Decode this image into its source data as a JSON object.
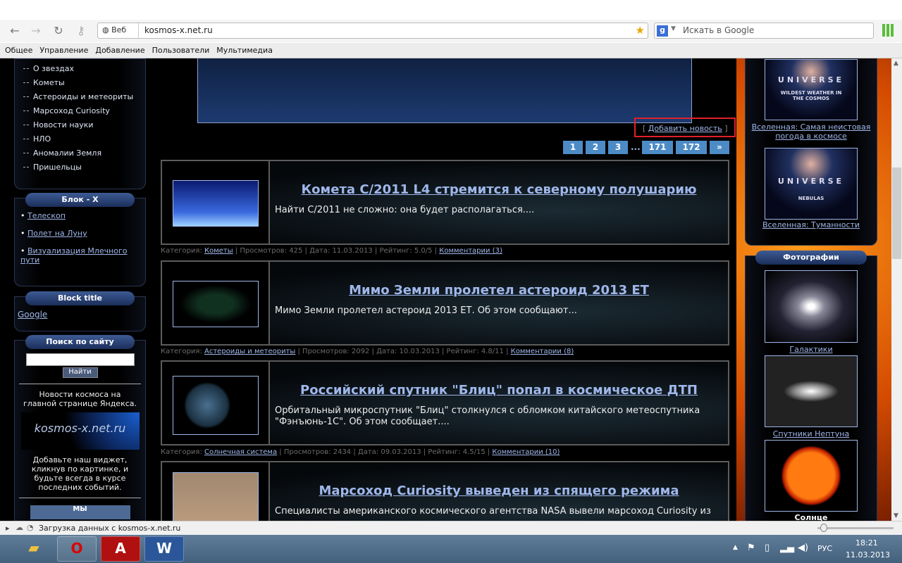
{
  "browser": {
    "web_label": "Веб",
    "url": "kosmos-x.net.ru",
    "search_placeholder": "Искать в Google",
    "bookmarks": [
      "Общее",
      "Управление",
      "Добавление",
      "Пользователи",
      "Мультимедиа"
    ],
    "status": "Загрузка данных с kosmos-x.net.ru"
  },
  "left": {
    "menu": [
      "О звездах",
      "Кометы",
      "Астероиды и метеориты",
      "Марсоход Curiosity",
      "Новости науки",
      "НЛО",
      "Аномалии Земля",
      "Пришельцы"
    ],
    "block_x": {
      "title": "Блок - X",
      "links": [
        "Телескоп",
        "Полет на Луну",
        "Визуализация Млечного пути"
      ]
    },
    "block_title": {
      "title": "Block title",
      "link": "Google"
    },
    "search": {
      "title": "Поиск по сайту",
      "value": "",
      "button": "Найти"
    },
    "yandex": {
      "text": "Новости космоса на главной странице Яндекса.",
      "banner": "kosmos-x.net.ru",
      "widget_text": "Добавьте наш виджет, кликнув по картинке, и будьте всегда в курсе последних событий.",
      "bottom": "МЫ"
    }
  },
  "center": {
    "add_news": "Добавить новость",
    "add_news_brackets": [
      "[",
      "]"
    ],
    "pagination": [
      "1",
      "2",
      "3",
      "...",
      "171",
      "172",
      "»"
    ],
    "news": [
      {
        "title": "Комета C/2011 L4 стремится к северному полушарию",
        "desc": "Найти C/2011 не сложно: она будет располагаться....",
        "cat_label": "Категория:",
        "category": "Кометы",
        "views": "Просмотров: 425",
        "date": "Дата: 11.03.2013",
        "rating": "Рейтинг: 5.0/5",
        "comments": "Комментарии (3)"
      },
      {
        "title": "Мимо Земли пролетел астероид 2013 ЕТ",
        "desc": "Мимо Земли пролетел астероид 2013 ЕТ. Об этом сообщают...",
        "cat_label": "Категория:",
        "category": "Астероиды и метеориты",
        "views": "Просмотров: 2092",
        "date": "Дата: 10.03.2013",
        "rating": "Рейтинг: 4.8/11",
        "comments": "Комментарии (8)"
      },
      {
        "title": "Российский спутник \"Блиц\" попал в космическое ДТП",
        "desc": "Орбитальный микроспутник \"Блиц\" столкнулся с обломком китайского метеоспутника \"Фэнъюнь-1С\". Об этом сообщает....",
        "cat_label": "Категория:",
        "category": "Солнечная система",
        "views": "Просмотров: 2434",
        "date": "Дата: 09.03.2013",
        "rating": "Рейтинг: 4.5/15",
        "comments": "Комментарии (10)"
      },
      {
        "title": "Марсоход Curiosity выведен из спящего режима",
        "desc": "Специалисты американского космического агентства NASA вывели марсоход Curiosity из"
      }
    ]
  },
  "right": {
    "videos": [
      {
        "caption": "Вселенная: Самая неистовая погода в космосе",
        "img_title": "UNIVERSE",
        "img_sub": "WILDEST WEATHER IN THE COSMOS"
      },
      {
        "caption": "Вселенная: Туманности",
        "img_title": "UNIVERSE",
        "img_sub": "NEBULAS"
      }
    ],
    "photos_title": "Фотографии",
    "photos": [
      "Галактики",
      "Спутники Нептуна",
      "Солнце"
    ]
  },
  "taskbar": {
    "lang": "РУС",
    "time": "18:21",
    "date": "11.03.2013"
  }
}
